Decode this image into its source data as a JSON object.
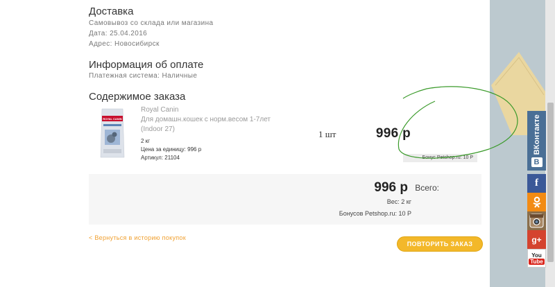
{
  "delivery": {
    "title": "Доставка",
    "method": "Самовывоз со склада или магазина",
    "date": "Дата: 25.04.2016",
    "address": "Адрес: Новосибирск"
  },
  "payment": {
    "title": "Информация об оплате",
    "system": "Платежная система: Наличные"
  },
  "order": {
    "title": "Содержимое заказа",
    "item": {
      "brand": "Royal Canin",
      "name": "Для домашн.кошек с норм.весом 1-7лет (Indoor 27)",
      "weight": "2 кг",
      "unit_price": "Цена за единицу: 996 р",
      "article": "Артикул: 21104",
      "quantity": "1 шт",
      "price": "996 р",
      "bonus": "Бонус Petshop.ru: 10 Р",
      "image_label": "ROYAL CANIN"
    }
  },
  "totals": {
    "total_label": "Всего:",
    "total_value": "996 р",
    "weight": "Вес: 2 кг",
    "bonus": "Бонусов Petshop.ru: 10 Р"
  },
  "actions": {
    "back_link": "< Вернуться в историю покупок",
    "repeat_button": "ПОВТОРИТЬ ЗАКАЗ"
  },
  "social": {
    "vk": "ВКонтакте",
    "vk_badge": "В",
    "facebook": "f",
    "odnoklassniki": "ok-icon",
    "instagram": "instagram-icon",
    "googleplus": "g+",
    "youtube_you": "You",
    "youtube_tube": "Tube"
  },
  "colors": {
    "accent_orange": "#f0a030",
    "button_yellow": "#f3b82a",
    "annotation_green": "#3a9a2a",
    "sidebar_bg": "#bcc9cf"
  }
}
